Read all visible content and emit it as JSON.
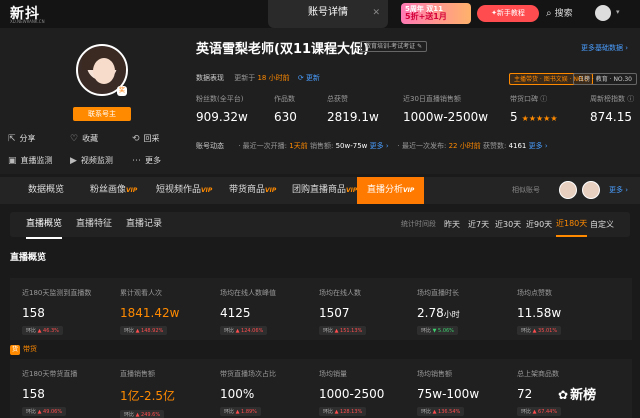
{
  "topbar": {
    "logo": "新抖",
    "logo_sub": "XD.NEWRANK.CN",
    "page_tab": "账号详情",
    "promo_line1": "5周年 双11",
    "promo_line2": "5折+送1月",
    "newbie": "✦新手教程",
    "search": "搜索"
  },
  "profile": {
    "name": "英语雪梨老师(双11课程大促)",
    "category_tag": "教育培训-考试考证 ✎",
    "contact_button": "联系号主",
    "more_link": "更多基础数据 ›",
    "data_label": "数据表现",
    "updated_prefix": "更新于",
    "updated_hours": "18 小时前",
    "update_link": "⟳ 更新",
    "rank_a": "主播带货 · 图书文娱 · NO.5",
    "rank_b": "日榜 · 教育 · NO.30",
    "badge": "奖"
  },
  "side_actions": [
    "分享",
    "收藏",
    "回采",
    "直播监测",
    "视频监测",
    "更多"
  ],
  "stats": [
    {
      "key": "粉丝数(全平台)",
      "value": "909.32w"
    },
    {
      "key": "作品数",
      "value": "630"
    },
    {
      "key": "总获赞",
      "value": "2819.1w"
    },
    {
      "key": "近30日直播销售额",
      "value": "1000w-2500w"
    },
    {
      "key": "带货口碑 ⓘ",
      "value": "5",
      "stars": "★★★★★"
    },
    {
      "key": "周新榜指数 ⓘ",
      "value": "874.15"
    }
  ],
  "dynamics": {
    "label": "账号动态",
    "live_prefix": "· 最近一次开播:",
    "live_time": "1天前",
    "live_sales_label": "销售额:",
    "live_sales": "50w-75w",
    "live_more": "更多 ›",
    "video_prefix": "· 最近一次发布:",
    "video_time": "22 小时前",
    "video_likes_label": "获赞数:",
    "video_likes": "4161",
    "video_more": "更多 ›"
  },
  "tabs": [
    {
      "label": "数据概览",
      "vip": ""
    },
    {
      "label": "粉丝画像",
      "vip": "VIP"
    },
    {
      "label": "短视频作品",
      "vip": "VIP"
    },
    {
      "label": "带货商品",
      "vip": "VIP"
    },
    {
      "label": "团购直播商品",
      "vip": "VIP"
    },
    {
      "label": "直播分析",
      "vip": "VIP"
    }
  ],
  "compare_label": "相似账号",
  "more2": "更多 ›",
  "subtabs": [
    "直播概览",
    "直播特征",
    "直播记录"
  ],
  "ranges": {
    "label": "统计时间段",
    "items": [
      "昨天",
      "近7天",
      "近30天",
      "近90天",
      "近180天",
      "自定义"
    ]
  },
  "section_title": "直播概览",
  "grid1": [
    {
      "k": "近180天监测到直播数",
      "v": "158",
      "c_label": "环比",
      "c": "▲ 46.3%",
      "dir": "up"
    },
    {
      "k": "累计观看人次",
      "v": "1841.42w",
      "c_label": "环比",
      "c": "▲ 148.92%",
      "dir": "up",
      "orange": true
    },
    {
      "k": "场均在线人数峰值",
      "v": "4125",
      "c_label": "环比",
      "c": "▲ 124.06%",
      "dir": "up"
    },
    {
      "k": "场均在线人数",
      "v": "1507",
      "c_label": "环比",
      "c": "▲ 151.13%",
      "dir": "up"
    },
    {
      "k": "场均直播时长",
      "v": "2.78",
      "unit": "小时",
      "c_label": "环比",
      "c": "▼ 5.06%",
      "dir": "down"
    },
    {
      "k": "场均点赞数",
      "v": "11.58w",
      "c_label": "环比",
      "c": "▲ 35.01%",
      "dir": "up"
    }
  ],
  "goods_tag": {
    "icon": "货",
    "label": "带货"
  },
  "grid2": [
    {
      "k": "近180天带货直播",
      "v": "158",
      "c_label": "环比",
      "c": "▲ 49.06%",
      "dir": "up"
    },
    {
      "k": "直播销售额",
      "v": "1亿-2.5亿",
      "c_label": "环比",
      "c": "▲ 249.6%",
      "dir": "up",
      "orange": true
    },
    {
      "k": "带货直播场次占比",
      "v": "100%",
      "c_label": "环比",
      "c": "▲ 1.89%",
      "dir": "up"
    },
    {
      "k": "场均销量",
      "v": "1000-2500",
      "c_label": "环比",
      "c": "▲ 128.13%",
      "dir": "up"
    },
    {
      "k": "场均销售额",
      "v": "75w-100w",
      "c_label": "环比",
      "c": "▲ 136.54%",
      "dir": "up"
    },
    {
      "k": "总上架商品数",
      "v": "72",
      "c_label": "环比",
      "c": "▲ 67.44%",
      "dir": "up"
    }
  ],
  "watermark": "新榜"
}
